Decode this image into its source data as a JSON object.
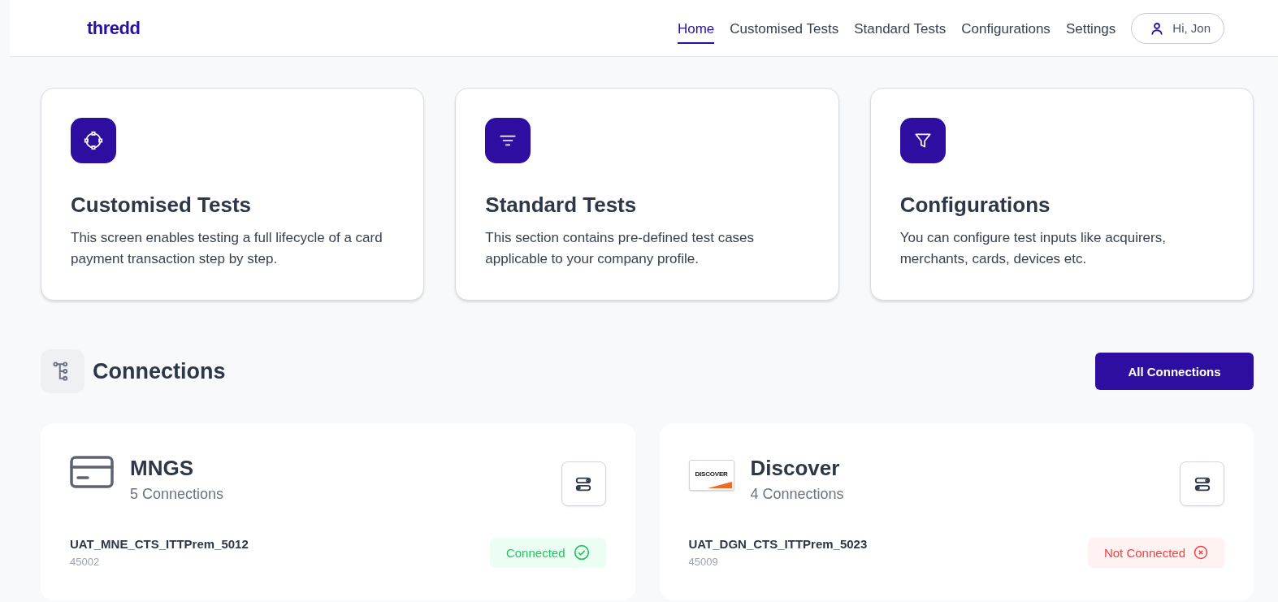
{
  "brand": "thredd",
  "nav": [
    {
      "label": "Home",
      "selected": true
    },
    {
      "label": "Customised Tests",
      "selected": false
    },
    {
      "label": "Standard Tests",
      "selected": false
    },
    {
      "label": "Configurations",
      "selected": false
    },
    {
      "label": "Settings",
      "selected": false
    }
  ],
  "user": {
    "label": "Hi, Jon"
  },
  "features": [
    {
      "kind": "nodes",
      "title": "Customised Tests",
      "description": "This screen enables testing a full lifecycle of a card payment transaction step by step."
    },
    {
      "kind": "lines",
      "title": "Standard Tests",
      "description": "This section contains pre-defined test cases applicable to your company profile."
    },
    {
      "kind": "funnel",
      "title": "Configurations",
      "description": "You can configure test inputs like acquirers, merchants, cards, devices etc."
    }
  ],
  "connections": {
    "title": "Connections",
    "button": "All Connections",
    "groups": [
      {
        "kind": "card",
        "name": "MNGS",
        "count": "5 Connections",
        "item": {
          "name": "UAT_MNE_CTS_ITTPrem_5012",
          "id": "45002",
          "status": {
            "kind": "connected",
            "label": "Connected"
          }
        }
      },
      {
        "kind": "discover",
        "logo_text": "DISCOVER",
        "name": "Discover",
        "count": "4 Connections",
        "item": {
          "name": "UAT_DGN_CTS_ITTPrem_5023",
          "id": "45009",
          "status": {
            "kind": "not_connected",
            "label": "Not Connected"
          }
        }
      }
    ]
  }
}
